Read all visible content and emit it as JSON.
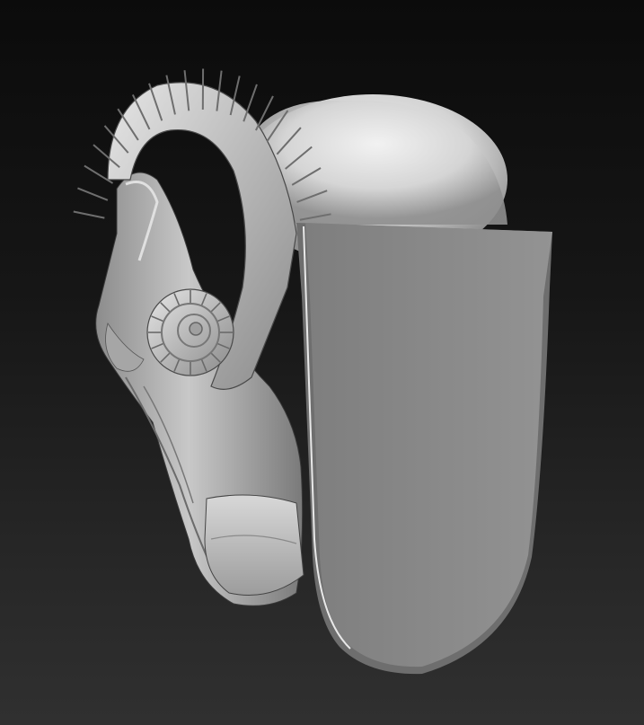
{
  "viewport": {
    "background_top": "#0b0b0b",
    "background_bottom": "#303030"
  },
  "model": {
    "subject": "ram-skull-sculpt",
    "material_color": "#bdbdbd",
    "plane_color": "#8a8a8a"
  }
}
